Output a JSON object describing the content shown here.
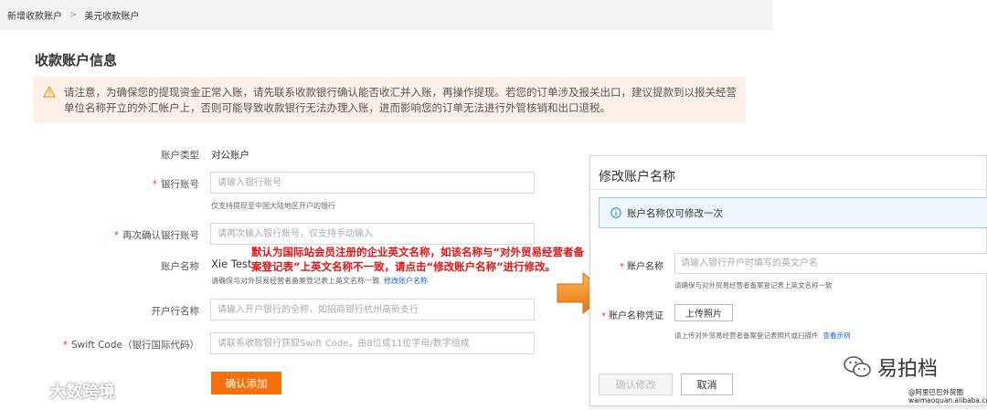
{
  "breadcrumb": {
    "item1": "新增收款账户",
    "separator": ">",
    "item2": "美元收款账户"
  },
  "page_title": "收款账户信息",
  "notice": {
    "text": "请注意，为确保您的提现资金正常入账，请先联系收款银行确认能否收汇并入账，再操作提现。若您的订单涉及报关出口，建议提款到以报关经营单位名称开立的外汇帐户上，否则可能导致收款银行无法办理入账，进而影响您的订单无法进行外管核销和出口退税。",
    "icon": "warning-icon"
  },
  "form": {
    "account_type": {
      "label": "账户类型",
      "value": "对公账户"
    },
    "bank_account": {
      "label": "银行账号",
      "placeholder": "请输入银行账号",
      "hint": "仅支持提现至中国大陆地区开户的银行"
    },
    "confirm_account": {
      "label": "再次确认银行账号",
      "placeholder": "请再次输入银行账号，仅支持手动输入"
    },
    "account_name": {
      "label": "账户名称",
      "value": "Xie Test",
      "hint": "请确保与对外贸易经营者备案登记表上英文名称一致",
      "link": "修改账户名称"
    },
    "bank_name": {
      "label": "开户行名称",
      "placeholder": "请输入开户银行的全称，如招商银行杭州高新支行"
    },
    "swift_code": {
      "label": "Swift Code（银行国际代码）",
      "placeholder": "请联系收款银行获取Swift Code，由8位或11位字母/数字组成"
    },
    "submit_label": "确认添加"
  },
  "annotation": "默认为国际站会员注册的企业英文名称，如该名称与“对外贸易经营者备案登记表”上英文名称不一致，请点击“修改账户名称”进行修改。",
  "watermark_left": "大数跨境",
  "modal": {
    "title": "修改账户名称",
    "info": "账户名称仅可修改一次",
    "name_field": {
      "label": "账户名称",
      "placeholder": "请输入银行开户时填写的英文户名",
      "hint": "请确保与对外贸易经营者备案登记表上英文名称一致"
    },
    "proof_field": {
      "label": "账户名称凭证",
      "upload_label": "上传照片",
      "hint": "请上传对外贸易经营者备案登记表照片或扫描件",
      "link": "查看示例"
    },
    "confirm_label": "确认修改",
    "cancel_label": "取消"
  },
  "watermark_right": {
    "title": "易拍档",
    "line1": "@阿里巴巴外贸圈",
    "line2": "waimaoquan.alibaba.com"
  },
  "colors": {
    "accent": "#f5700a",
    "required": "#e4393c",
    "annotation": "#e41313",
    "link": "#1a66c8",
    "notice_bg": "#fdf0e8",
    "info_bg": "#eef6fe"
  }
}
